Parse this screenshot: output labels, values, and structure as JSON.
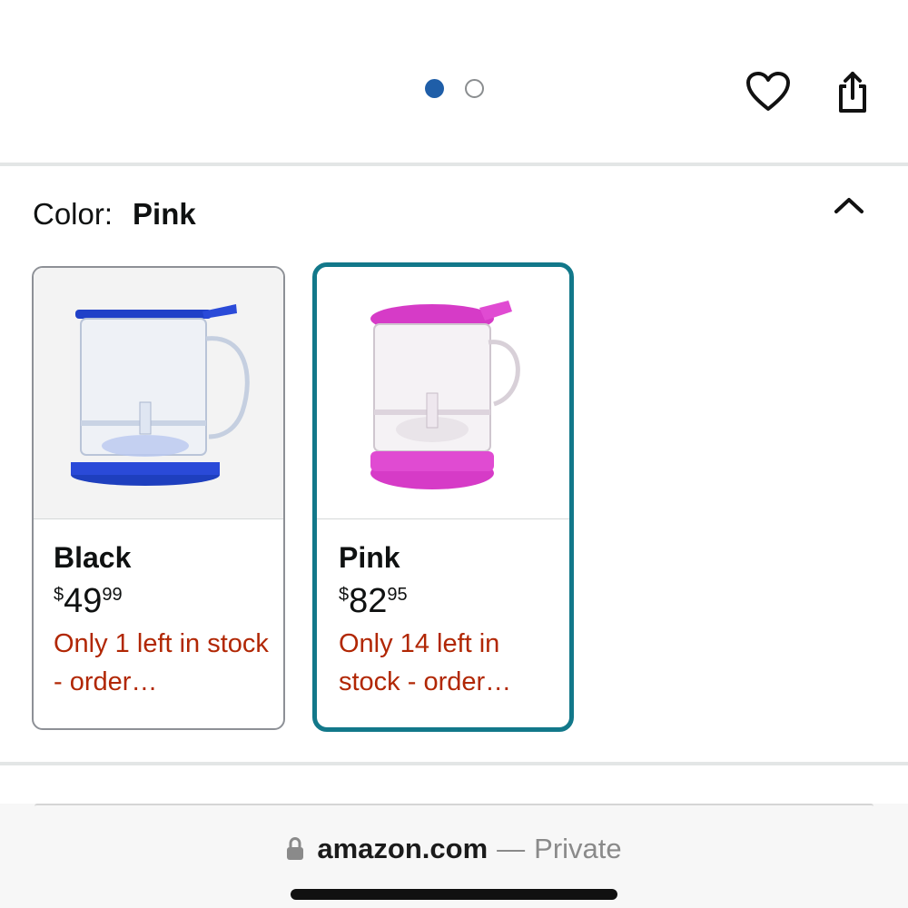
{
  "carousel": {
    "page_count": 2,
    "active_index": 0
  },
  "color_selector": {
    "label": "Color:",
    "selected": "Pink",
    "expanded": true
  },
  "swatches": [
    {
      "name": "Black",
      "price_symbol": "$",
      "price_whole": "49",
      "price_fraction": "99",
      "stock": "Only 1 left in stock - order…",
      "accent": "#1f3fd1",
      "selected": false
    },
    {
      "name": "Pink",
      "price_symbol": "$",
      "price_whole": "82",
      "price_fraction": "95",
      "stock": "Only 14 left in stock - order…",
      "accent": "#d63bc7",
      "selected": true
    }
  ],
  "browser": {
    "domain": "amazon.com",
    "separator": "—",
    "mode": "Private"
  },
  "colors": {
    "active_dot": "#1f5ea8",
    "selected_border": "#12788a",
    "stock_text": "#b12704"
  }
}
